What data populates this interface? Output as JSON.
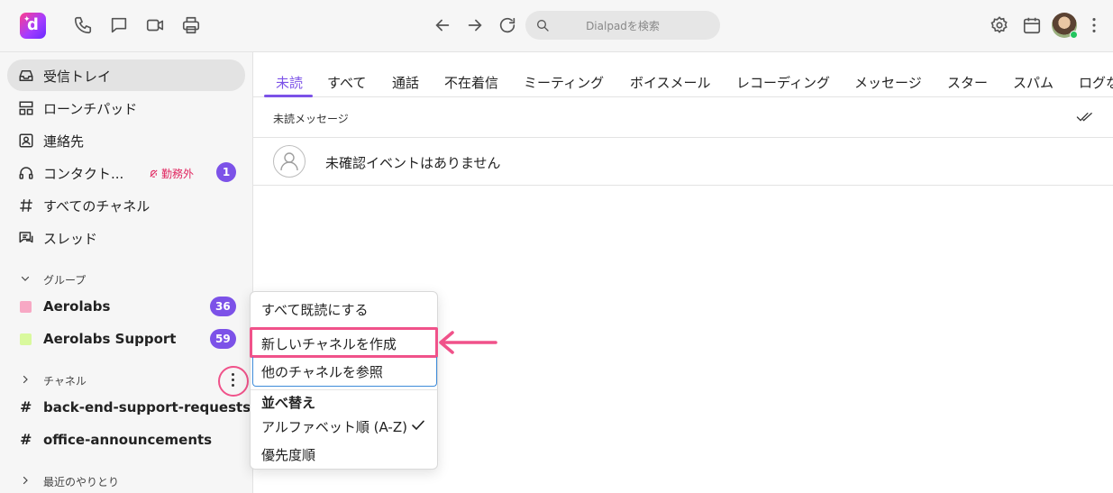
{
  "app": {
    "logo_letter": "d",
    "search_placeholder": "Dialpadを検索",
    "accent_color": "#7c52e8",
    "highlight_color": "#f0528a"
  },
  "topbar_icons": [
    "phone-icon",
    "chat-icon",
    "video-icon",
    "printer-icon",
    "back-arrow-icon",
    "forward-arrow-icon",
    "refresh-icon",
    "search-icon",
    "gear-icon",
    "calendar-icon",
    "avatar",
    "more-vertical-icon"
  ],
  "sidebar": {
    "nav": [
      {
        "label": "受信トレイ",
        "icon": "inbox-icon"
      },
      {
        "label": "ローンチパッド",
        "icon": "launchpad-icon"
      },
      {
        "label": "連絡先",
        "icon": "contacts-icon"
      },
      {
        "label": "コンタクト...",
        "icon": "headset-icon",
        "status": "勤務外",
        "badge": "1"
      },
      {
        "label": "すべてのチャネル",
        "icon": "hash-icon"
      },
      {
        "label": "スレッド",
        "icon": "threads-icon"
      }
    ],
    "groups_header": "グループ",
    "groups": [
      {
        "label": "Aerolabs",
        "badge": "36",
        "color": "#f7a8c4"
      },
      {
        "label": "Aerolabs Support",
        "badge": "59",
        "color": "#d9f99d"
      }
    ],
    "channels_header": "チャネル",
    "channels": [
      {
        "label": "back-end-support-requests"
      },
      {
        "label": "office-announcements"
      }
    ],
    "recent_header": "最近のやりとり"
  },
  "tabs": [
    "未読",
    "すべて",
    "通話",
    "不在着信",
    "ミーティング",
    "ボイスメール",
    "レコーディング",
    "メッセージ",
    "スター",
    "スパム",
    "ログな"
  ],
  "main": {
    "subhead": "未読メッセージ",
    "empty_text": "未確認イベントはありません"
  },
  "menu": {
    "mark_all_read": "すべて既読にする",
    "create_channel": "新しいチャネルを作成",
    "browse_channels": "他のチャネルを参照",
    "sort_header": "並べ替え",
    "sort_alpha": "アルファベット順 (A-Z)",
    "sort_priority": "優先度順"
  }
}
